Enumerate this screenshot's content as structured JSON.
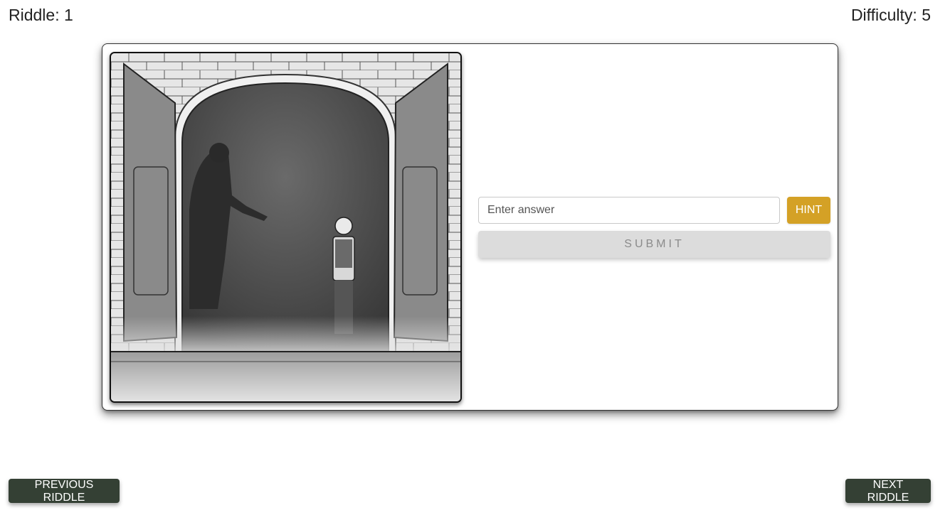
{
  "header": {
    "riddle": "Riddle: 1",
    "difficulty": "Difficulty: 5"
  },
  "puzzle": {
    "illustration": "grayscale-doorway-illustration",
    "answer_placeholder": "Enter answer",
    "answer_value": "",
    "hint_label": "HINT",
    "submit_label": "SUBMIT"
  },
  "navigation": {
    "previous_label": "PREVIOUS RIDDLE",
    "next_label": "NEXT RIDDLE"
  },
  "colors": {
    "hint": "#d4a126",
    "nav": "#344034",
    "submit_disabled": "#dcdcdc"
  }
}
